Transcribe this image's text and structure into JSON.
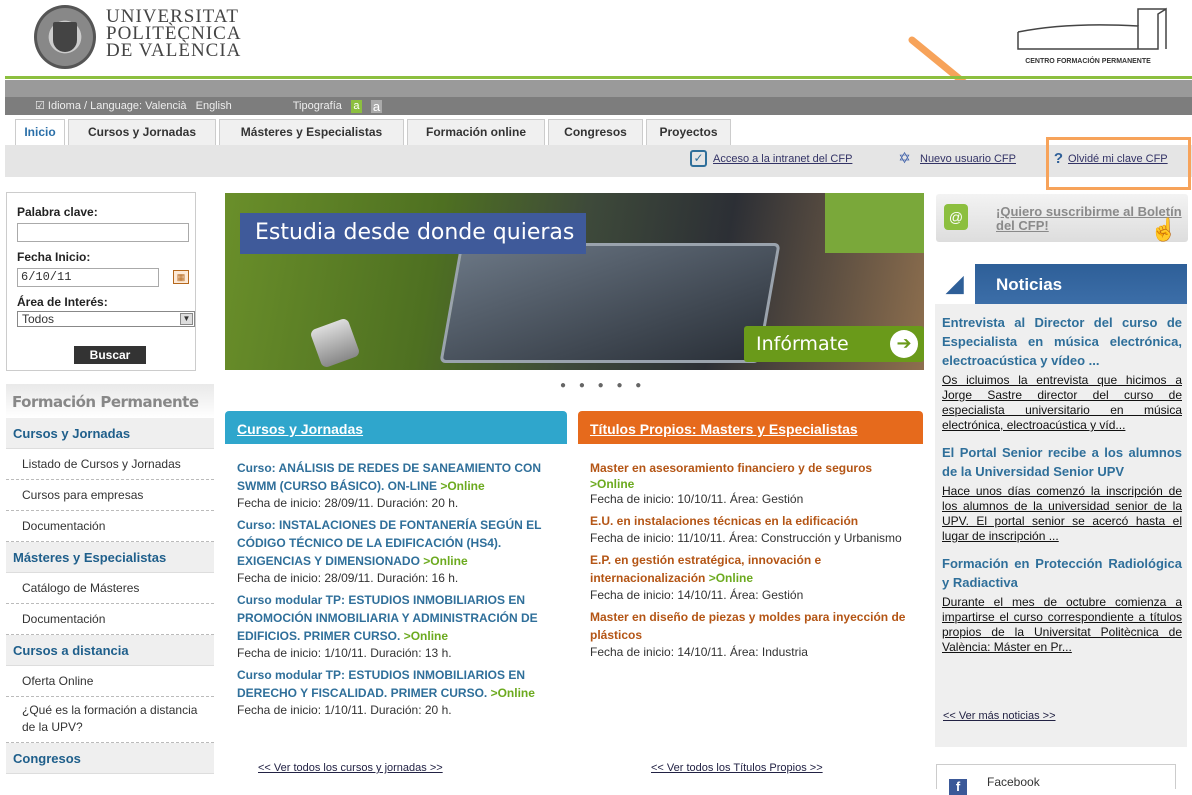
{
  "header": {
    "university_name": [
      "UNIVERSITAT",
      "POLITÈCNICA",
      "DE VALÈNCIA"
    ],
    "cfp_name": "CENTRO FORMACIÓN PERMANENTE"
  },
  "toolbar": {
    "language_label": "☑ Idioma / Language: Valencià",
    "english": "English",
    "typography": "Tipografía",
    "tipo_small": "a",
    "tipo_large": "a"
  },
  "tabs": [
    "Inicio",
    "Cursos y Jornadas",
    "Másteres y Especialistas",
    "Formación online",
    "Congresos",
    "Proyectos"
  ],
  "user_links": {
    "intranet": "Acceso a la intranet del CFP",
    "new_user": "Nuevo usuario CFP",
    "forgot": "Olvidé mi clave CFP"
  },
  "search": {
    "keyword_label": "Palabra clave:",
    "keyword_value": "",
    "date_label": "Fecha Inicio:",
    "date_value": "6/10/11",
    "area_label": "Área de Interés:",
    "area_value": "Todos",
    "button": "Buscar"
  },
  "left_nav": {
    "title": "Formación Permanente",
    "sections": [
      {
        "head": "Cursos y Jornadas",
        "items": [
          "Listado de Cursos y Jornadas",
          "Cursos para empresas",
          "Documentación"
        ]
      },
      {
        "head": "Másteres y Especialistas",
        "items": [
          "Catálogo de Másteres",
          "Documentación"
        ]
      },
      {
        "head": "Cursos a distancia",
        "items": [
          "Oferta Online",
          "¿Qué es la formación a distancia de la UPV?"
        ]
      },
      {
        "head": "Congresos",
        "items": []
      }
    ]
  },
  "banner": {
    "title": "Estudia desde donde quieras",
    "cta": "Infórmate aquí",
    "dots": "● ● ● ● ●"
  },
  "colors": {
    "cursos": "#2fa6cc",
    "titulos": "#e66a1c",
    "green": "#8cbf3f",
    "highlight": "#f7a35a"
  },
  "cursos": {
    "heading": "Cursos y Jornadas",
    "items": [
      {
        "title": "Curso: ANÁLISIS DE REDES DE SANEAMIENTO CON SWMM (CURSO BÁSICO). ON-LINE",
        "online": ">Online",
        "meta": "Fecha de inicio: 28/09/11. Duración: 20 h."
      },
      {
        "title": "Curso: INSTALACIONES DE FONTANERÍA SEGÚN EL CÓDIGO TÉCNICO DE LA EDIFICACIÓN (HS4). EXIGENCIAS Y DIMENSIONADO",
        "online": ">Online",
        "meta": "Fecha de inicio: 28/09/11. Duración: 16 h."
      },
      {
        "title": "Curso modular TP: ESTUDIOS INMOBILIARIOS EN PROMOCIÓN INMOBILIARIA Y ADMINISTRACIÓN DE EDIFICIOS. PRIMER CURSO.",
        "online": ">Online",
        "meta": "Fecha de inicio: 1/10/11. Duración: 13 h."
      },
      {
        "title": "Curso modular TP: ESTUDIOS INMOBILIARIOS EN DERECHO Y FISCALIDAD. PRIMER CURSO.",
        "online": ">Online",
        "meta": "Fecha de inicio: 1/10/11. Duración: 20 h."
      }
    ],
    "see_all": "<< Ver todos los cursos y jornadas >>"
  },
  "titulos": {
    "heading": "Títulos Propios: Masters y Especialistas",
    "items": [
      {
        "title": "Master en asesoramiento financiero y de seguros",
        "online": ">Online",
        "meta": "Fecha de inicio: 10/10/11. Área: Gestión"
      },
      {
        "title": "E.U. en instalaciones técnicas en la edificación",
        "online": "",
        "meta": "Fecha de inicio: 11/10/11. Área: Construcción y Urbanismo"
      },
      {
        "title": "E.P. en gestión estratégica, innovación e internacionalización",
        "online": ">Online",
        "meta": "Fecha de inicio: 14/10/11. Área: Gestión"
      },
      {
        "title": "Master en diseño de piezas y moldes para inyección de plásticos",
        "online": "",
        "meta": "Fecha de inicio: 14/10/11. Área: Industria"
      }
    ],
    "see_all": "<< Ver todos los Títulos Propios >>"
  },
  "boletin": "¡Quiero suscribirme al Boletín del CFP!",
  "noticias": {
    "heading": "Noticias",
    "items": [
      {
        "title": "Entrevista al Director del curso de Especialista en música electrónica, electroacústica y vídeo ...",
        "body": "Os icluimos la entrevista que hicimos a Jorge Sastre director del curso de especialista universitario en música electrónica, electroacústica y víd..."
      },
      {
        "title": "El Portal Senior recibe a los alumnos de la Universidad Senior UPV",
        "body": "Hace unos días comenzó la inscripción de los alumnos de la universidad senior de la UPV. El portal senior se acercó hasta el lugar de inscripción ..."
      },
      {
        "title": "Formación en Protección Radiológica y Radiactiva",
        "body": "Durante el mes de octubre comienza a impartirse el curso correspondiente a títulos propios de la Universitat Politècnica de València: Máster en Pr..."
      }
    ],
    "see_more": "<< Ver más noticias >>"
  },
  "facebook": "Facebook"
}
